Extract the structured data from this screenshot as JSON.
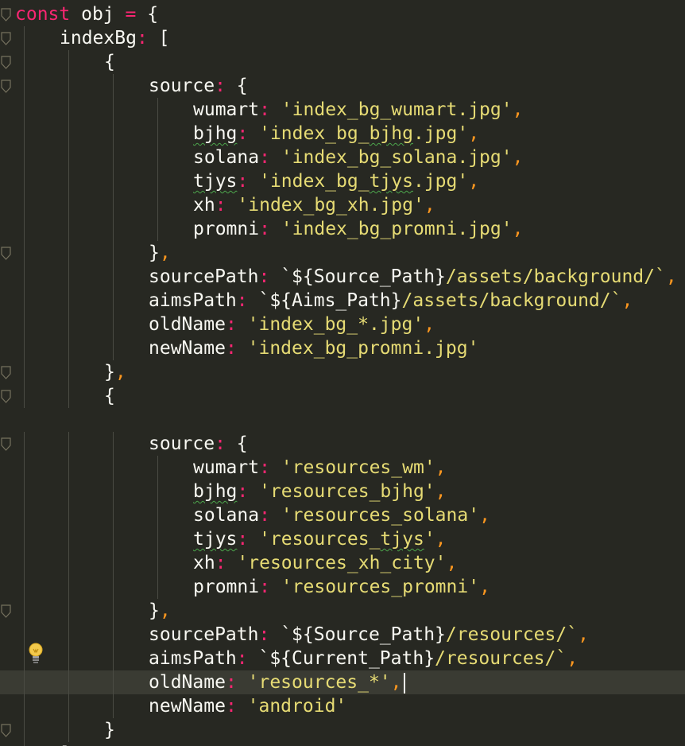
{
  "editor": {
    "lines": [
      {
        "tokens": [
          {
            "t": "const",
            "c": "kw"
          },
          {
            "t": " obj ",
            "c": "pn"
          },
          {
            "t": "=",
            "c": "op"
          },
          {
            "t": " {",
            "c": "pn"
          }
        ]
      },
      {
        "tokens": [
          {
            "t": "indexBg",
            "c": "prop"
          },
          {
            "t": ":",
            "c": "op"
          },
          {
            "t": " [",
            "c": "pn"
          }
        ]
      },
      {
        "tokens": [
          {
            "t": "{",
            "c": "pn"
          }
        ]
      },
      {
        "tokens": [
          {
            "t": "source",
            "c": "prop"
          },
          {
            "t": ":",
            "c": "op"
          },
          {
            "t": " {",
            "c": "pn"
          }
        ]
      },
      {
        "tokens": [
          {
            "t": "wumart",
            "c": "prop"
          },
          {
            "t": ":",
            "c": "op"
          },
          {
            "t": " 'index_bg_wumart.jpg'",
            "c": "str"
          },
          {
            "t": ",",
            "c": "comma"
          }
        ]
      },
      {
        "tokens": [
          {
            "t": "bjhg",
            "c": "prop sq"
          },
          {
            "t": ":",
            "c": "op"
          },
          {
            "t": " 'index_bg_",
            "c": "str"
          },
          {
            "t": "bjhg",
            "c": "str sq"
          },
          {
            "t": ".jpg'",
            "c": "str"
          },
          {
            "t": ",",
            "c": "comma"
          }
        ]
      },
      {
        "tokens": [
          {
            "t": "solana",
            "c": "prop"
          },
          {
            "t": ":",
            "c": "op"
          },
          {
            "t": " 'index_bg_solana.jpg'",
            "c": "str"
          },
          {
            "t": ",",
            "c": "comma"
          }
        ]
      },
      {
        "tokens": [
          {
            "t": "tjys",
            "c": "prop sq"
          },
          {
            "t": ":",
            "c": "op"
          },
          {
            "t": " 'index_bg_",
            "c": "str"
          },
          {
            "t": "tjys",
            "c": "str sq"
          },
          {
            "t": ".jpg'",
            "c": "str"
          },
          {
            "t": ",",
            "c": "comma"
          }
        ]
      },
      {
        "tokens": [
          {
            "t": "xh",
            "c": "prop"
          },
          {
            "t": ":",
            "c": "op"
          },
          {
            "t": " 'index_bg_xh.jpg'",
            "c": "str"
          },
          {
            "t": ",",
            "c": "comma"
          }
        ]
      },
      {
        "tokens": [
          {
            "t": "promni",
            "c": "prop"
          },
          {
            "t": ":",
            "c": "op"
          },
          {
            "t": " 'index_bg_promni.jpg'",
            "c": "str"
          },
          {
            "t": ",",
            "c": "comma"
          }
        ]
      },
      {
        "tokens": [
          {
            "t": "}",
            "c": "pn"
          },
          {
            "t": ",",
            "c": "comma"
          }
        ]
      },
      {
        "tokens": [
          {
            "t": "sourcePath",
            "c": "prop"
          },
          {
            "t": ":",
            "c": "op"
          },
          {
            "t": " `${Source_Path}",
            "c": "pn"
          },
          {
            "t": "/assets/background/`",
            "c": "str"
          },
          {
            "t": ",",
            "c": "comma"
          }
        ]
      },
      {
        "tokens": [
          {
            "t": "aimsPath",
            "c": "prop"
          },
          {
            "t": ":",
            "c": "op"
          },
          {
            "t": " `${Aims_Path}",
            "c": "pn"
          },
          {
            "t": "/assets/background/`",
            "c": "str"
          },
          {
            "t": ",",
            "c": "comma"
          }
        ]
      },
      {
        "tokens": [
          {
            "t": "oldName",
            "c": "prop"
          },
          {
            "t": ":",
            "c": "op"
          },
          {
            "t": " 'index_bg_*.jpg'",
            "c": "str"
          },
          {
            "t": ",",
            "c": "comma"
          }
        ]
      },
      {
        "tokens": [
          {
            "t": "newName",
            "c": "prop"
          },
          {
            "t": ":",
            "c": "op"
          },
          {
            "t": " 'index_bg_promni.jpg'",
            "c": "str"
          }
        ]
      },
      {
        "tokens": [
          {
            "t": "}",
            "c": "pn"
          },
          {
            "t": ",",
            "c": "comma"
          }
        ]
      },
      {
        "tokens": [
          {
            "t": "{",
            "c": "pn"
          }
        ]
      },
      {
        "tokens": []
      },
      {
        "tokens": [
          {
            "t": "source",
            "c": "prop"
          },
          {
            "t": ":",
            "c": "op"
          },
          {
            "t": " {",
            "c": "pn"
          }
        ]
      },
      {
        "tokens": [
          {
            "t": "wumart",
            "c": "prop"
          },
          {
            "t": ":",
            "c": "op"
          },
          {
            "t": " 'resources_wm'",
            "c": "str"
          },
          {
            "t": ",",
            "c": "comma"
          }
        ]
      },
      {
        "tokens": [
          {
            "t": "bjhg",
            "c": "prop sq"
          },
          {
            "t": ":",
            "c": "op"
          },
          {
            "t": " 'resources_bjhg'",
            "c": "str"
          },
          {
            "t": ",",
            "c": "comma"
          }
        ]
      },
      {
        "tokens": [
          {
            "t": "solana",
            "c": "prop"
          },
          {
            "t": ":",
            "c": "op"
          },
          {
            "t": " 'resources_solana'",
            "c": "str"
          },
          {
            "t": ",",
            "c": "comma"
          }
        ]
      },
      {
        "tokens": [
          {
            "t": "tjys",
            "c": "prop sq"
          },
          {
            "t": ":",
            "c": "op"
          },
          {
            "t": " 'resources_",
            "c": "str"
          },
          {
            "t": "tjys",
            "c": "str sq"
          },
          {
            "t": "'",
            "c": "str"
          },
          {
            "t": ",",
            "c": "comma"
          }
        ]
      },
      {
        "tokens": [
          {
            "t": "xh",
            "c": "prop"
          },
          {
            "t": ":",
            "c": "op"
          },
          {
            "t": " 'resources_xh_city'",
            "c": "str"
          },
          {
            "t": ",",
            "c": "comma"
          }
        ]
      },
      {
        "tokens": [
          {
            "t": "promni",
            "c": "prop"
          },
          {
            "t": ":",
            "c": "op"
          },
          {
            "t": " 'resources_promni'",
            "c": "str"
          },
          {
            "t": ",",
            "c": "comma"
          }
        ]
      },
      {
        "tokens": [
          {
            "t": "}",
            "c": "pn"
          },
          {
            "t": ",",
            "c": "comma"
          }
        ]
      },
      {
        "tokens": [
          {
            "t": "sourcePath",
            "c": "prop"
          },
          {
            "t": ":",
            "c": "op"
          },
          {
            "t": " `${Source_Path}",
            "c": "pn"
          },
          {
            "t": "/resources/`",
            "c": "str"
          },
          {
            "t": ",",
            "c": "comma"
          }
        ]
      },
      {
        "tokens": [
          {
            "t": "aimsPath",
            "c": "prop"
          },
          {
            "t": ":",
            "c": "op"
          },
          {
            "t": " `${Current_Path}",
            "c": "pn"
          },
          {
            "t": "/resources/`",
            "c": "str"
          },
          {
            "t": ",",
            "c": "comma"
          }
        ]
      },
      {
        "tokens": [
          {
            "t": "oldName",
            "c": "prop"
          },
          {
            "t": ":",
            "c": "op"
          },
          {
            "t": " 'resources_*'",
            "c": "str"
          },
          {
            "t": ",",
            "c": "comma"
          }
        ],
        "active": true,
        "cursor": true
      },
      {
        "tokens": [
          {
            "t": "newName",
            "c": "prop"
          },
          {
            "t": ":",
            "c": "op"
          },
          {
            "t": " 'android'",
            "c": "str"
          }
        ]
      },
      {
        "tokens": [
          {
            "t": "}",
            "c": "pn"
          }
        ]
      },
      {
        "tokens": [
          {
            "t": "]",
            "c": "pn"
          },
          {
            "t": ",",
            "c": "comma"
          }
        ]
      }
    ]
  },
  "icons": {
    "fold": "fold-marker-icon",
    "hint": "lightbulb-icon"
  },
  "colors": {
    "background": "#272822",
    "keyword": "#f92672",
    "string": "#e6db74",
    "comma": "#fd971f",
    "text": "#f8f8f2"
  }
}
